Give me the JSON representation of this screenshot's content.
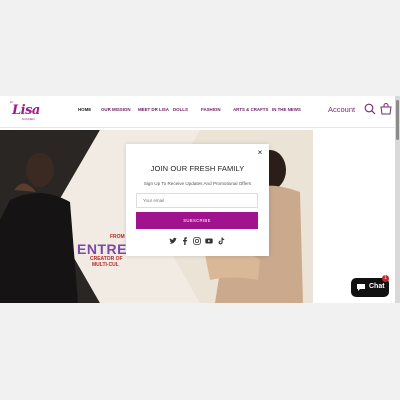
{
  "header": {
    "logo": {
      "pre": "Dr.",
      "script": "Lisa",
      "sub": "GOLDEN"
    },
    "nav": [
      {
        "label": "HOME"
      },
      {
        "label": "OUR MISSION"
      },
      {
        "label": "MEET DR LISA"
      },
      {
        "label": "DOLLS"
      },
      {
        "label": "FASHION"
      },
      {
        "label": "ARTS & CRAFTS"
      },
      {
        "label": "IN THE NEWS"
      }
    ],
    "account_label": "Account"
  },
  "hero": {
    "from_text": "FROM",
    "headline": "ENTRE",
    "sub_line1": "CREATOR OF",
    "sub_line2": "MULTI-CUL"
  },
  "popup": {
    "close_glyph": "×",
    "title": "JOIN OUR FRESH FAMILY",
    "subtitle": "Sign Up To Receive Updates And Promotional Offers",
    "email_placeholder": "Your email",
    "subscribe_label": "SUBSCRIBE",
    "social_icons": [
      "twitter-icon",
      "facebook-icon",
      "instagram-icon",
      "youtube-icon",
      "tiktok-icon"
    ]
  },
  "chat": {
    "label": "Chat",
    "badge": "1"
  },
  "colors": {
    "brand": "#a1128f",
    "nav": "#6b1d5e"
  }
}
